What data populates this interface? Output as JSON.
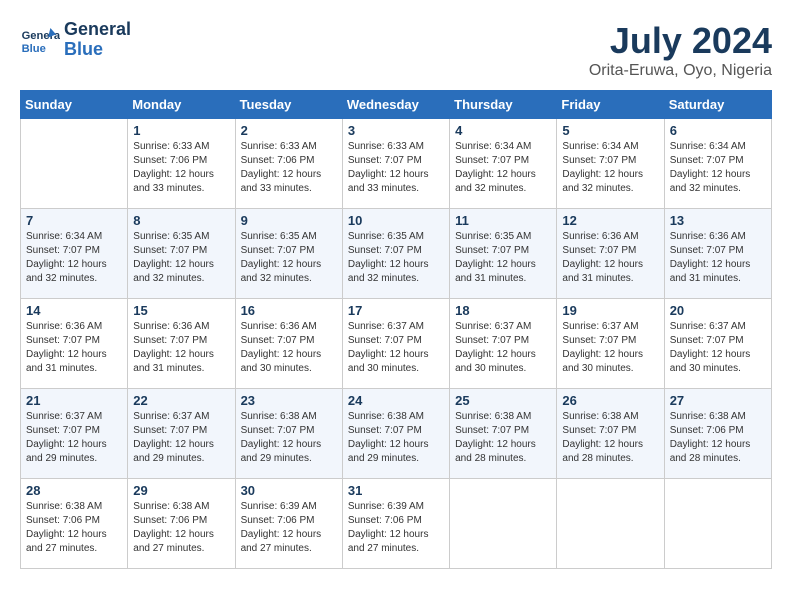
{
  "header": {
    "logo_line1": "General",
    "logo_line2": "Blue",
    "month_year": "July 2024",
    "location": "Orita-Eruwa, Oyo, Nigeria"
  },
  "columns": [
    "Sunday",
    "Monday",
    "Tuesday",
    "Wednesday",
    "Thursday",
    "Friday",
    "Saturday"
  ],
  "weeks": [
    [
      {
        "day": "",
        "info": ""
      },
      {
        "day": "1",
        "info": "Sunrise: 6:33 AM\nSunset: 7:06 PM\nDaylight: 12 hours\nand 33 minutes."
      },
      {
        "day": "2",
        "info": "Sunrise: 6:33 AM\nSunset: 7:06 PM\nDaylight: 12 hours\nand 33 minutes."
      },
      {
        "day": "3",
        "info": "Sunrise: 6:33 AM\nSunset: 7:07 PM\nDaylight: 12 hours\nand 33 minutes."
      },
      {
        "day": "4",
        "info": "Sunrise: 6:34 AM\nSunset: 7:07 PM\nDaylight: 12 hours\nand 32 minutes."
      },
      {
        "day": "5",
        "info": "Sunrise: 6:34 AM\nSunset: 7:07 PM\nDaylight: 12 hours\nand 32 minutes."
      },
      {
        "day": "6",
        "info": "Sunrise: 6:34 AM\nSunset: 7:07 PM\nDaylight: 12 hours\nand 32 minutes."
      }
    ],
    [
      {
        "day": "7",
        "info": "Sunrise: 6:34 AM\nSunset: 7:07 PM\nDaylight: 12 hours\nand 32 minutes."
      },
      {
        "day": "8",
        "info": "Sunrise: 6:35 AM\nSunset: 7:07 PM\nDaylight: 12 hours\nand 32 minutes."
      },
      {
        "day": "9",
        "info": "Sunrise: 6:35 AM\nSunset: 7:07 PM\nDaylight: 12 hours\nand 32 minutes."
      },
      {
        "day": "10",
        "info": "Sunrise: 6:35 AM\nSunset: 7:07 PM\nDaylight: 12 hours\nand 32 minutes."
      },
      {
        "day": "11",
        "info": "Sunrise: 6:35 AM\nSunset: 7:07 PM\nDaylight: 12 hours\nand 31 minutes."
      },
      {
        "day": "12",
        "info": "Sunrise: 6:36 AM\nSunset: 7:07 PM\nDaylight: 12 hours\nand 31 minutes."
      },
      {
        "day": "13",
        "info": "Sunrise: 6:36 AM\nSunset: 7:07 PM\nDaylight: 12 hours\nand 31 minutes."
      }
    ],
    [
      {
        "day": "14",
        "info": "Sunrise: 6:36 AM\nSunset: 7:07 PM\nDaylight: 12 hours\nand 31 minutes."
      },
      {
        "day": "15",
        "info": "Sunrise: 6:36 AM\nSunset: 7:07 PM\nDaylight: 12 hours\nand 31 minutes."
      },
      {
        "day": "16",
        "info": "Sunrise: 6:36 AM\nSunset: 7:07 PM\nDaylight: 12 hours\nand 30 minutes."
      },
      {
        "day": "17",
        "info": "Sunrise: 6:37 AM\nSunset: 7:07 PM\nDaylight: 12 hours\nand 30 minutes."
      },
      {
        "day": "18",
        "info": "Sunrise: 6:37 AM\nSunset: 7:07 PM\nDaylight: 12 hours\nand 30 minutes."
      },
      {
        "day": "19",
        "info": "Sunrise: 6:37 AM\nSunset: 7:07 PM\nDaylight: 12 hours\nand 30 minutes."
      },
      {
        "day": "20",
        "info": "Sunrise: 6:37 AM\nSunset: 7:07 PM\nDaylight: 12 hours\nand 30 minutes."
      }
    ],
    [
      {
        "day": "21",
        "info": "Sunrise: 6:37 AM\nSunset: 7:07 PM\nDaylight: 12 hours\nand 29 minutes."
      },
      {
        "day": "22",
        "info": "Sunrise: 6:37 AM\nSunset: 7:07 PM\nDaylight: 12 hours\nand 29 minutes."
      },
      {
        "day": "23",
        "info": "Sunrise: 6:38 AM\nSunset: 7:07 PM\nDaylight: 12 hours\nand 29 minutes."
      },
      {
        "day": "24",
        "info": "Sunrise: 6:38 AM\nSunset: 7:07 PM\nDaylight: 12 hours\nand 29 minutes."
      },
      {
        "day": "25",
        "info": "Sunrise: 6:38 AM\nSunset: 7:07 PM\nDaylight: 12 hours\nand 28 minutes."
      },
      {
        "day": "26",
        "info": "Sunrise: 6:38 AM\nSunset: 7:07 PM\nDaylight: 12 hours\nand 28 minutes."
      },
      {
        "day": "27",
        "info": "Sunrise: 6:38 AM\nSunset: 7:06 PM\nDaylight: 12 hours\nand 28 minutes."
      }
    ],
    [
      {
        "day": "28",
        "info": "Sunrise: 6:38 AM\nSunset: 7:06 PM\nDaylight: 12 hours\nand 27 minutes."
      },
      {
        "day": "29",
        "info": "Sunrise: 6:38 AM\nSunset: 7:06 PM\nDaylight: 12 hours\nand 27 minutes."
      },
      {
        "day": "30",
        "info": "Sunrise: 6:39 AM\nSunset: 7:06 PM\nDaylight: 12 hours\nand 27 minutes."
      },
      {
        "day": "31",
        "info": "Sunrise: 6:39 AM\nSunset: 7:06 PM\nDaylight: 12 hours\nand 27 minutes."
      },
      {
        "day": "",
        "info": ""
      },
      {
        "day": "",
        "info": ""
      },
      {
        "day": "",
        "info": ""
      }
    ]
  ]
}
